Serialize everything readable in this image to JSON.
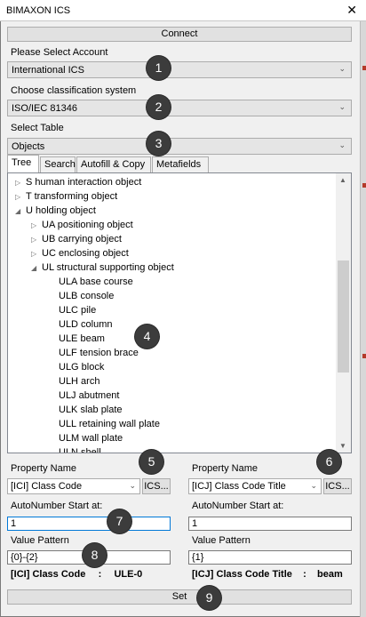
{
  "window": {
    "title": "BIMAXON ICS",
    "close_glyph": "✕"
  },
  "connect_button": "Connect",
  "account": {
    "label": "Please Select Account",
    "value": "International ICS"
  },
  "classification": {
    "label": "Choose classification system",
    "value": "ISO/IEC 81346"
  },
  "table": {
    "label": "Select Table",
    "value": "Objects"
  },
  "tabs": [
    {
      "label": "Tree",
      "active": true
    },
    {
      "label": "Search"
    },
    {
      "label": "Autofill & Copy"
    },
    {
      "label": "Metafields"
    }
  ],
  "tree_items": [
    {
      "text": "S human interaction object",
      "level": 0,
      "state": "collapsed"
    },
    {
      "text": "T transforming object",
      "level": 0,
      "state": "collapsed"
    },
    {
      "text": "U holding object",
      "level": 0,
      "state": "expanded"
    },
    {
      "text": "UA positioning object",
      "level": 1,
      "state": "collapsed"
    },
    {
      "text": "UB carrying object",
      "level": 1,
      "state": "collapsed"
    },
    {
      "text": "UC enclosing object",
      "level": 1,
      "state": "collapsed"
    },
    {
      "text": "UL structural supporting object",
      "level": 1,
      "state": "expanded"
    },
    {
      "text": "ULA base course",
      "level": 2,
      "state": "leaf"
    },
    {
      "text": "ULB console",
      "level": 2,
      "state": "leaf"
    },
    {
      "text": "ULC pile",
      "level": 2,
      "state": "leaf"
    },
    {
      "text": "ULD column",
      "level": 2,
      "state": "leaf"
    },
    {
      "text": "ULE beam",
      "level": 2,
      "state": "leaf"
    },
    {
      "text": "ULF tension brace",
      "level": 2,
      "state": "leaf"
    },
    {
      "text": "ULG block",
      "level": 2,
      "state": "leaf"
    },
    {
      "text": "ULH arch",
      "level": 2,
      "state": "leaf"
    },
    {
      "text": "ULJ abutment",
      "level": 2,
      "state": "leaf"
    },
    {
      "text": "ULK slab plate",
      "level": 2,
      "state": "leaf"
    },
    {
      "text": "ULL retaining wall plate",
      "level": 2,
      "state": "leaf"
    },
    {
      "text": "ULM wall plate",
      "level": 2,
      "state": "leaf"
    },
    {
      "text": "ULN shell",
      "level": 2,
      "state": "leaf"
    }
  ],
  "left_panel": {
    "property_label": "Property Name",
    "property_value": "[ICI] Class Code",
    "ics_button": "ICS...",
    "autonumber_label": "AutoNumber Start at:",
    "autonumber_value": "1",
    "pattern_label": "Value Pattern",
    "pattern_value": "{0}-{2}",
    "result_name": "[ICI] Class Code",
    "result_sep": ":",
    "result_value": "ULE-0"
  },
  "right_panel": {
    "property_label": "Property Name",
    "property_value": "[ICJ] Class Code Title",
    "ics_button": "ICS...",
    "autonumber_label": "AutoNumber Start at:",
    "autonumber_value": "1",
    "pattern_label": "Value Pattern",
    "pattern_value": "{1}",
    "result_name": "[ICJ] Class Code Title",
    "result_sep": ":",
    "result_value": "beam"
  },
  "set_button": "Set",
  "badges": [
    "1",
    "2",
    "3",
    "4",
    "5",
    "6",
    "7",
    "8",
    "9"
  ],
  "icons": {
    "tree_collapsed": "▷",
    "tree_expanded": "◢",
    "dropdown": "⌄",
    "scroll_up": "▲",
    "scroll_down": "▼"
  },
  "colors": {
    "badge": "#3c3c3c",
    "focus_border": "#0078d7",
    "tick": "#b43a2a"
  }
}
